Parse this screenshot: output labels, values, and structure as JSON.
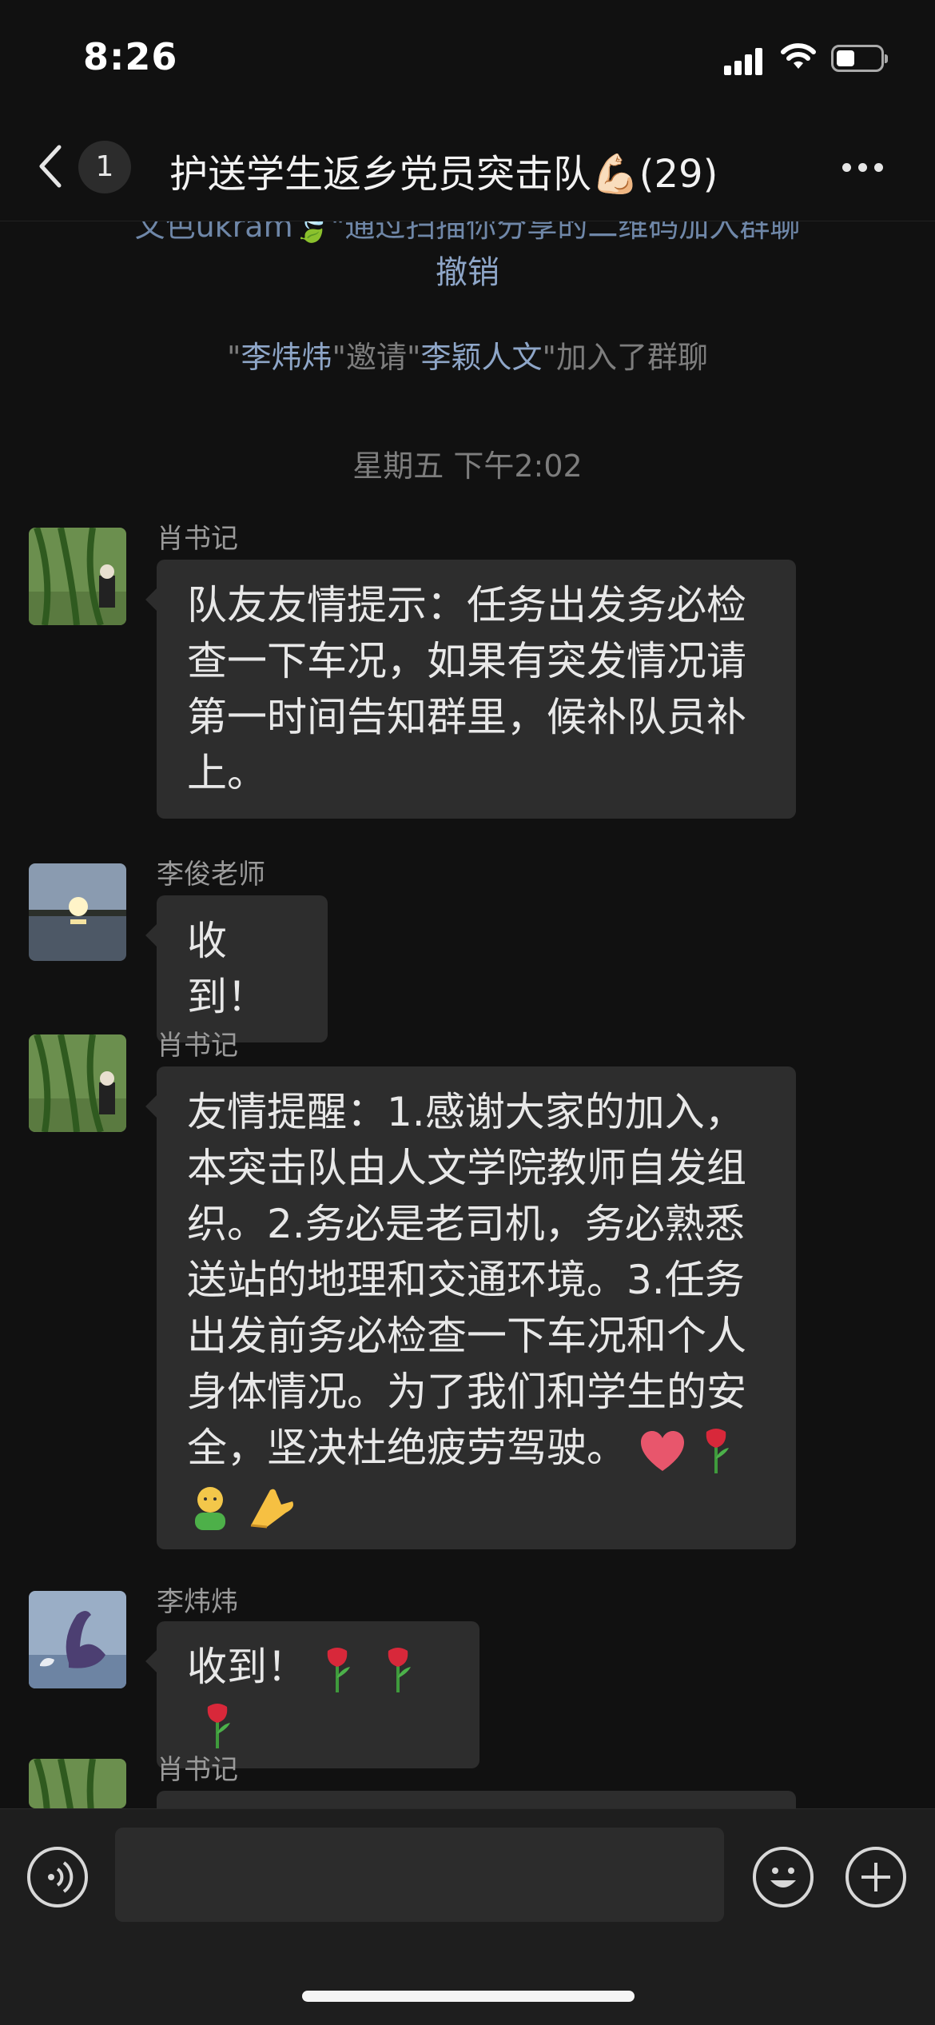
{
  "status_bar": {
    "time": "8:26"
  },
  "header": {
    "back_unread_count": "1",
    "title": "护送学生返乡党员突击队💪🏻(29)"
  },
  "system": {
    "cut_off_line": "文色ukram🍃\"通过扫描你分享的二维码加入群聊",
    "revoke_label": "撤销",
    "join_notice": {
      "q1": "\"",
      "inviter": "李炜炜",
      "mid": "\"邀请\"",
      "invitee": "李颖人文",
      "tail": "\"加入了群聊"
    },
    "timestamp": "星期五 下午2:02"
  },
  "messages": [
    {
      "sender": "肖书记",
      "avatar_icon": "willow-tree-avatar",
      "lines": [
        "队友友情提示：任务出发务必检",
        "查一下车况，如果有突发情况请",
        "第一时间告知群里，候补队员补",
        "上。"
      ]
    },
    {
      "sender": "李俊老师",
      "avatar_icon": "sunset-lake-avatar",
      "lines": [
        "收到！"
      ]
    },
    {
      "sender": "肖书记",
      "avatar_icon": "willow-tree-avatar",
      "lines": [
        "友情提醒：1.感谢大家的加入，",
        "本突击队由人文学院教师自发组",
        "织。2.务必是老司机，务必熟悉",
        "送站的地理和交通环境。3.任务",
        "出发前务必检查一下车况和个人",
        "身体情况。为了我们和学生的安",
        "全，坚决杜绝疲劳驾驶。"
      ],
      "trailing_emoji": [
        "heart-icon",
        "rose-icon"
      ],
      "last_line_emoji": [
        "person-icon",
        "clap-icon"
      ]
    },
    {
      "sender": "李炜炜",
      "avatar_icon": "swan-avatar",
      "lines": [
        "收到！"
      ],
      "trailing_emoji": [
        "rose-icon",
        "rose-icon",
        "rose-icon"
      ]
    },
    {
      "sender": "肖书记",
      "avatar_icon": "willow-tree-avatar",
      "lines": []
    }
  ],
  "input": {
    "placeholder": ""
  }
}
